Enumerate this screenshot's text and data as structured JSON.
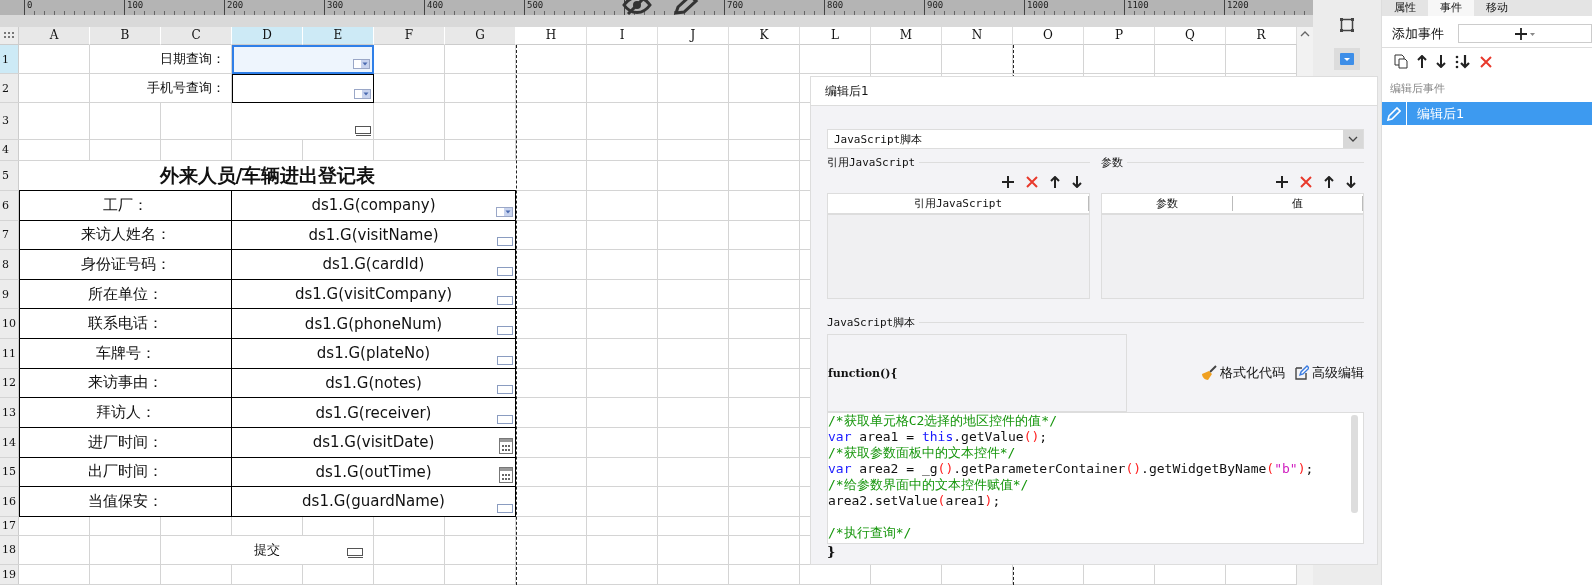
{
  "ruler": {
    "ticks": [
      {
        "kind": "labeled",
        "label": "0"
      },
      {
        "kind": "labeled",
        "label": "100"
      },
      {
        "kind": "labeled",
        "label": "200"
      },
      {
        "kind": "labeled",
        "label": "300"
      },
      {
        "kind": "labeled",
        "label": "400"
      },
      {
        "kind": "labeled",
        "label": "500"
      },
      {
        "kind": "covered"
      },
      {
        "kind": "labeled",
        "label": "700"
      },
      {
        "kind": "labeled",
        "label": "800"
      },
      {
        "kind": "labeled",
        "label": "900"
      },
      {
        "kind": "labeled",
        "label": "1000"
      },
      {
        "kind": "labeled",
        "label": "1100"
      },
      {
        "kind": "labeled",
        "label": "1200"
      }
    ]
  },
  "sheet": {
    "columns": [
      {
        "label": "A",
        "selected": false
      },
      {
        "label": "B",
        "selected": false
      },
      {
        "label": "C",
        "selected": false
      },
      {
        "label": "D",
        "selected": true
      },
      {
        "label": "E",
        "selected": true
      },
      {
        "label": "F",
        "selected": false
      },
      {
        "label": "G",
        "selected": false
      },
      {
        "label": "H",
        "selected": false
      },
      {
        "label": "I",
        "selected": false
      },
      {
        "label": "J",
        "selected": false
      },
      {
        "label": "K",
        "selected": false
      },
      {
        "label": "L",
        "selected": false
      },
      {
        "label": "M",
        "selected": false
      },
      {
        "label": "N",
        "selected": false
      },
      {
        "label": "O",
        "selected": false
      },
      {
        "label": "P",
        "selected": false
      },
      {
        "label": "Q",
        "selected": false
      },
      {
        "label": "R",
        "selected": false
      }
    ],
    "rows": [
      {
        "label": "1",
        "selected": true
      },
      {
        "label": "2",
        "selected": false
      },
      {
        "label": "3",
        "selected": false
      },
      {
        "label": "4",
        "selected": false
      },
      {
        "label": "5",
        "selected": false
      },
      {
        "label": "6",
        "selected": false
      },
      {
        "label": "7",
        "selected": false
      },
      {
        "label": "8",
        "selected": false
      },
      {
        "label": "9",
        "selected": false
      },
      {
        "label": "10",
        "selected": false
      },
      {
        "label": "11",
        "selected": false
      },
      {
        "label": "12",
        "selected": false
      },
      {
        "label": "13",
        "selected": false
      },
      {
        "label": "14",
        "selected": false
      },
      {
        "label": "15",
        "selected": false
      },
      {
        "label": "16",
        "selected": false
      },
      {
        "label": "17",
        "selected": false
      },
      {
        "label": "18",
        "selected": false
      },
      {
        "label": "19",
        "selected": false
      }
    ]
  },
  "query": [
    {
      "kind": "combo",
      "label": "日期查询：",
      "selected": true
    },
    {
      "kind": "combo",
      "label": "手机号查询：",
      "selected": false
    },
    {
      "kind": "button"
    }
  ],
  "form": {
    "title": "外来人员/车辆进出登记表",
    "rows": [
      {
        "label": "工厂：",
        "value": "ds1.G(company)",
        "kind": "combo"
      },
      {
        "label": "来访人姓名：",
        "value": "ds1.G(visitName)",
        "kind": "text"
      },
      {
        "label": "身份证号码：",
        "value": "ds1.G(cardId)",
        "kind": "text"
      },
      {
        "label": "所在单位：",
        "value": "ds1.G(visitCompany)",
        "kind": "text"
      },
      {
        "label": "联系电话：",
        "value": "ds1.G(phoneNum)",
        "kind": "text"
      },
      {
        "label": "车牌号：",
        "value": "ds1.G(plateNo)",
        "kind": "text"
      },
      {
        "label": "来访事由：",
        "value": "ds1.G(notes)",
        "kind": "text"
      },
      {
        "label": "拜访人：",
        "value": "ds1.G(receiver)",
        "kind": "text"
      },
      {
        "label": "进厂时间：",
        "value": "ds1.G(visitDate)",
        "kind": "date"
      },
      {
        "label": "出厂时间：",
        "value": "ds1.G(outTime)",
        "kind": "date"
      },
      {
        "label": "当值保安：",
        "value": "ds1.G(guardName)",
        "kind": "text"
      }
    ]
  },
  "submit": {
    "label": "提交",
    "kind": "button"
  },
  "dialog": {
    "title": "编辑后1",
    "type_select": "JavaScript脚本",
    "reference": {
      "label": "引用JavaScript",
      "columns": [
        "引用JavaScript"
      ]
    },
    "parameters": {
      "label": "参数",
      "columns": [
        "参数",
        "值"
      ]
    },
    "script_label": "JavaScript脚本",
    "function_header": "function(){",
    "actions": [
      {
        "kind": "format",
        "label": "格式化代码"
      },
      {
        "kind": "advanced",
        "label": "高级编辑"
      }
    ],
    "code_lines": [
      {
        "kind": "code",
        "tokens": [
          {
            "kind": "comment",
            "text": "/*获取单元格C2选择的地区控件的值*/"
          }
        ]
      },
      {
        "kind": "code",
        "tokens": [
          {
            "kind": "keyword",
            "text": "var"
          },
          {
            "kind": "plain",
            "text": " area1 = "
          },
          {
            "kind": "keyword",
            "text": "this"
          },
          {
            "kind": "plain",
            "text": ".getValue"
          },
          {
            "kind": "paren",
            "text": "()"
          },
          {
            "kind": "plain",
            "text": ";"
          }
        ]
      },
      {
        "kind": "code",
        "tokens": [
          {
            "kind": "comment",
            "text": "/*获取参数面板中的文本控件*/"
          }
        ]
      },
      {
        "kind": "code",
        "tokens": [
          {
            "kind": "keyword",
            "text": "var"
          },
          {
            "kind": "plain",
            "text": " area2 = _g"
          },
          {
            "kind": "paren",
            "text": "()"
          },
          {
            "kind": "plain",
            "text": ".getParameterContainer"
          },
          {
            "kind": "paren",
            "text": "()"
          },
          {
            "kind": "plain",
            "text": ".getWidgetByName"
          },
          {
            "kind": "paren",
            "text": "("
          },
          {
            "kind": "string",
            "text": "\"b\""
          },
          {
            "kind": "paren",
            "text": ")"
          },
          {
            "kind": "plain",
            "text": ";"
          }
        ]
      },
      {
        "kind": "code",
        "tokens": [
          {
            "kind": "comment",
            "text": "/*给参数界面中的文本控件赋值*/"
          }
        ]
      },
      {
        "kind": "code",
        "tokens": [
          {
            "kind": "plain",
            "text": "area2.setValue"
          },
          {
            "kind": "paren",
            "text": "("
          },
          {
            "kind": "plain",
            "text": "area1"
          },
          {
            "kind": "paren",
            "text": ")"
          },
          {
            "kind": "plain",
            "text": ";"
          }
        ]
      },
      {
        "kind": "blank"
      },
      {
        "kind": "code",
        "tokens": [
          {
            "kind": "comment",
            "text": "/*执行查询*/"
          }
        ]
      }
    ],
    "function_footer": "}"
  },
  "panel": {
    "tabs": [
      {
        "label": "属性",
        "selected": false
      },
      {
        "label": "事件",
        "selected": true
      },
      {
        "label": "移动",
        "selected": false
      }
    ],
    "add_event_label": "添加事件",
    "event_group": "编辑后事件",
    "events": [
      {
        "label": "编辑后1",
        "selected": true
      }
    ]
  }
}
